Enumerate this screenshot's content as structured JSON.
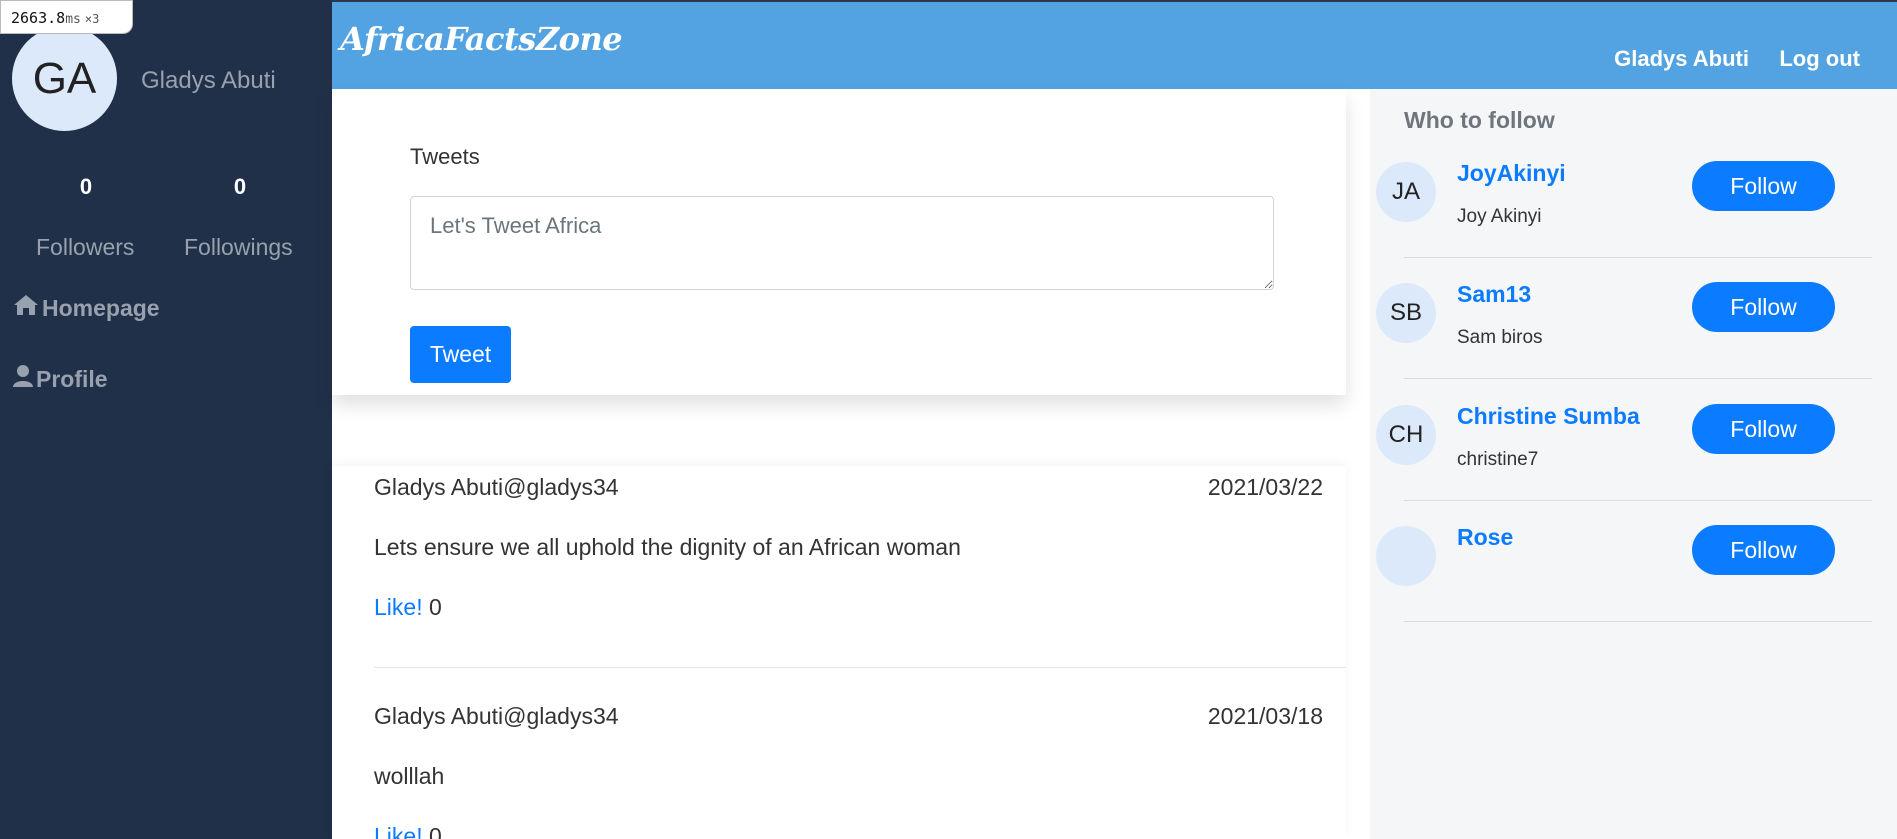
{
  "perf": {
    "value": "2663.8",
    "unit": "ms",
    "mult": "×3"
  },
  "sidebar": {
    "avatar_initials": "GA",
    "username": "Gladys Abuti",
    "followers_count": "0",
    "followers_label": "Followers",
    "followings_count": "0",
    "followings_label": "Followings",
    "nav": [
      {
        "label": "Homepage",
        "icon": "home-icon"
      },
      {
        "label": "Profile",
        "icon": "user-icon"
      }
    ]
  },
  "header": {
    "brand": "AfricaFactsZone",
    "user": "Gladys Abuti",
    "logout": "Log out"
  },
  "composer": {
    "label": "Tweets",
    "placeholder": "Let's Tweet Africa",
    "button": "Tweet"
  },
  "feed": {
    "tweets": [
      {
        "author": "Gladys Abuti@gladys34",
        "date": "2021/03/22",
        "body": "Lets ensure we all uphold the dignity of an African woman",
        "like_label": "Like!",
        "likes": "0"
      },
      {
        "author": "Gladys Abuti@gladys34",
        "date": "2021/03/18",
        "body": "wolllah",
        "like_label": "Like!",
        "likes": "0"
      }
    ]
  },
  "who_to_follow": {
    "title": "Who to follow",
    "button_label": "Follow",
    "users": [
      {
        "initials": "JA",
        "name": "JoyAkinyi",
        "handle": "Joy Akinyi"
      },
      {
        "initials": "SB",
        "name": "Sam13",
        "handle": "Sam biros"
      },
      {
        "initials": "CH",
        "name": "Christine Sumba",
        "handle": "christine7"
      },
      {
        "initials": "",
        "name": "Rose",
        "handle": ""
      }
    ]
  },
  "colors": {
    "sidebar_bg": "#213049",
    "header_bg": "#53a3e2",
    "accent": "#0b7bff",
    "muted_text": "#98a1ad"
  }
}
